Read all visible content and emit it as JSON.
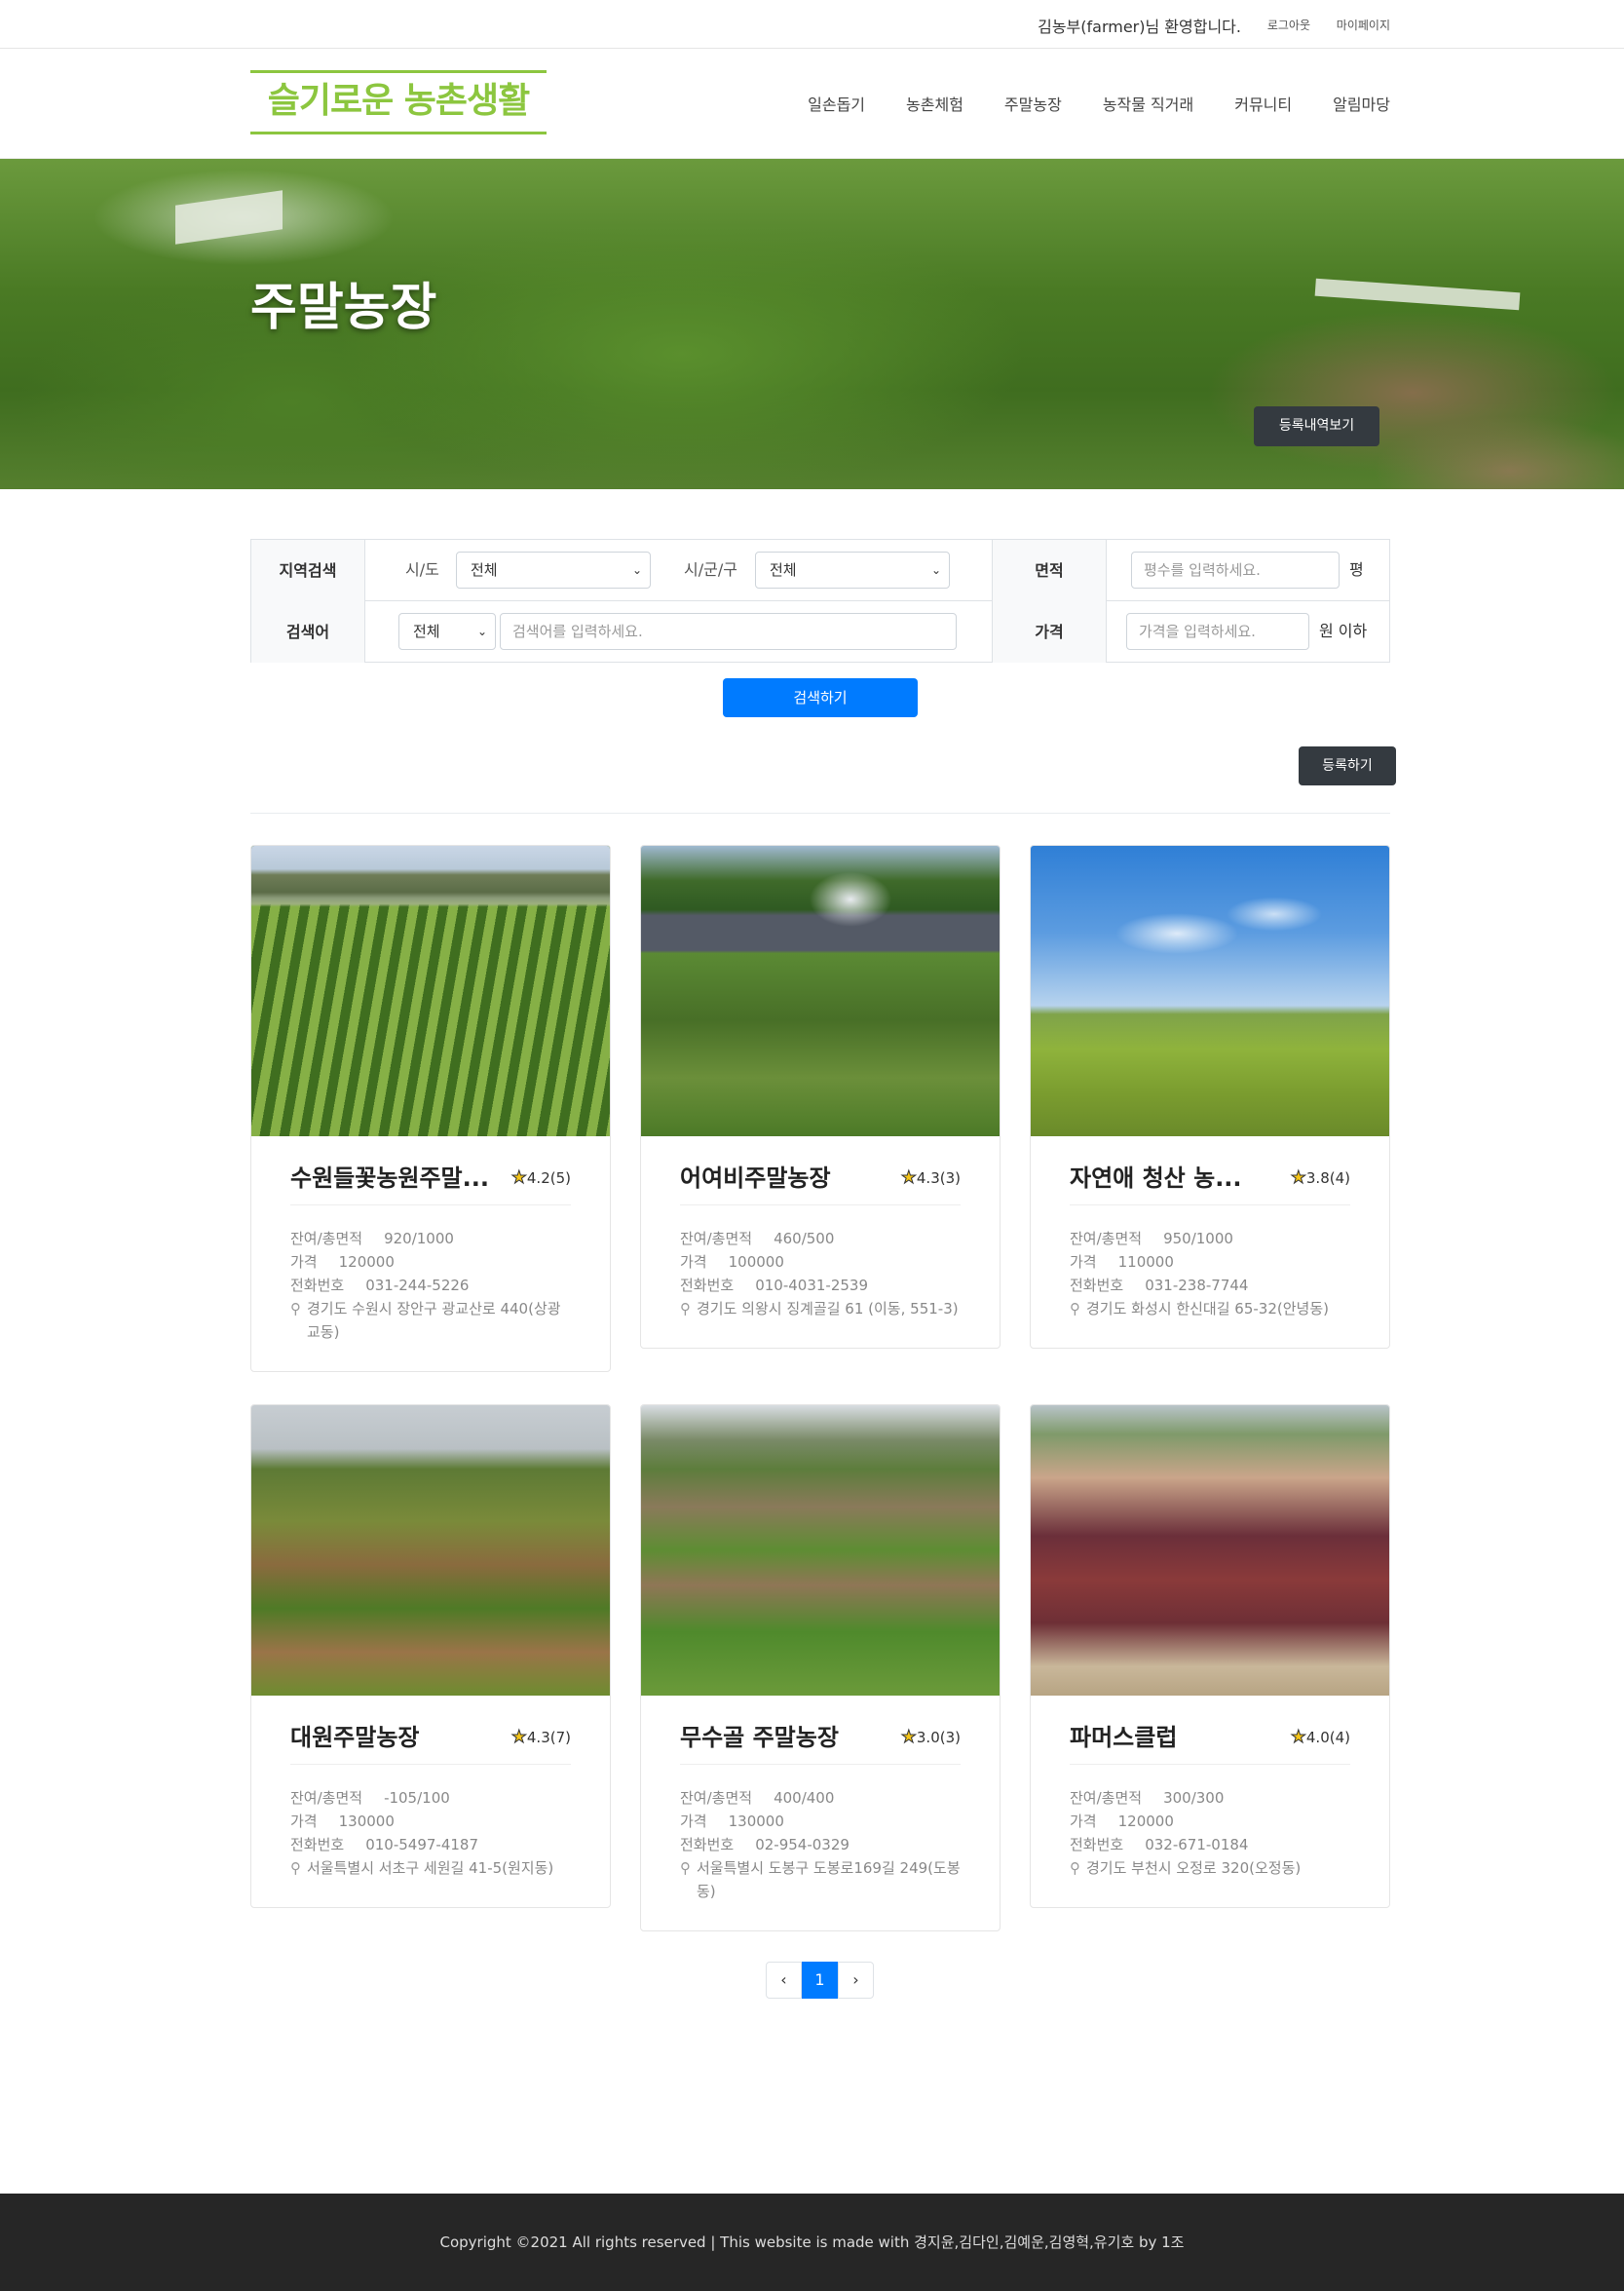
{
  "topbar": {
    "welcome": "김농부(farmer)님 환영합니다.",
    "logout": "로그아웃",
    "mypage": "마이페이지"
  },
  "header": {
    "logo": "슬기로운 농촌생활",
    "nav": [
      "일손돕기",
      "농촌체험",
      "주말농장",
      "농작물 직거래",
      "커뮤니티",
      "알림마당"
    ]
  },
  "hero": {
    "title": "주말농장",
    "history_button": "등록내역보기"
  },
  "search": {
    "region_label": "지역검색",
    "sido_label": "시/도",
    "sido_value": "전체",
    "sigungu_label": "시/군/구",
    "sigungu_value": "전체",
    "area_label": "면적",
    "area_placeholder": "평수를 입력하세요.",
    "area_unit": "평",
    "keyword_label": "검색어",
    "keyword_type": "전체",
    "keyword_placeholder": "검색어를 입력하세요.",
    "price_label": "가격",
    "price_placeholder": "가격을 입력하세요.",
    "price_unit": "원 이하",
    "search_button": "검색하기",
    "register_button": "등록하기"
  },
  "labels": {
    "remaining": "잔여/총면적",
    "price": "가격",
    "phone": "전화번호"
  },
  "farms": [
    {
      "name": "수원들꽃농원주말...",
      "rating": "4.2(5)",
      "area": "920/1000",
      "price": "120000",
      "phone": "031-244-5226",
      "address": "경기도 수원시 장안구 광교산로 440(상광교동)"
    },
    {
      "name": "어여비주말농장",
      "rating": "4.3(3)",
      "area": "460/500",
      "price": "100000",
      "phone": "010-4031-2539",
      "address": "경기도 의왕시 징계골길 61 (이동, 551-3)"
    },
    {
      "name": "자연애 청산 농...",
      "rating": "3.8(4)",
      "area": "950/1000",
      "price": "110000",
      "phone": "031-238-7744",
      "address": "경기도 화성시 한신대길 65-32(안녕동)"
    },
    {
      "name": "대원주말농장",
      "rating": "4.3(7)",
      "area": "-105/100",
      "price": "130000",
      "phone": "010-5497-4187",
      "address": "서울특별시 서초구 세원길 41-5(원지동)"
    },
    {
      "name": "무수골 주말농장",
      "rating": "3.0(3)",
      "area": "400/400",
      "price": "130000",
      "phone": "02-954-0329",
      "address": "서울특별시 도봉구 도봉로169길 249(도봉동)"
    },
    {
      "name": "파머스클럽",
      "rating": "4.0(4)",
      "area": "300/300",
      "price": "120000",
      "phone": "032-671-0184",
      "address": "경기도 부천시 오정로 320(오정동)"
    }
  ],
  "pagination": {
    "prev": "‹",
    "current": "1",
    "next": "›"
  },
  "footer": {
    "copyright": "Copyright ©2021 All rights reserved | This website is made with 경지윤,김다인,김예운,김영혁,유기호 by 1조"
  }
}
